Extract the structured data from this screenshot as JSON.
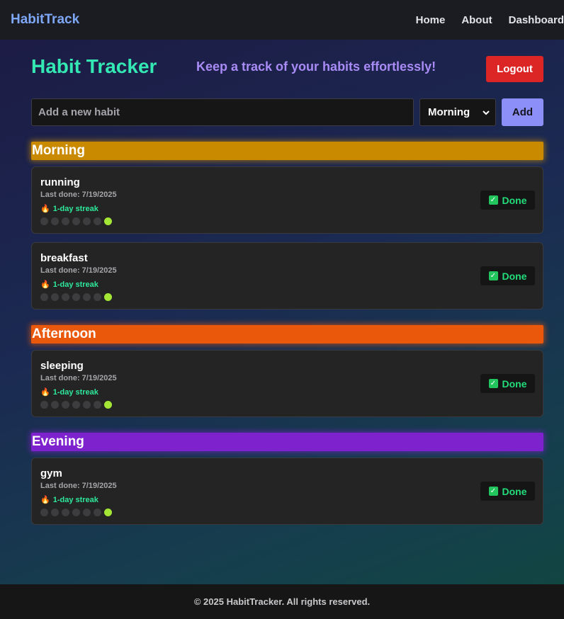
{
  "nav": {
    "brand": "HabitTrack",
    "links": [
      "Home",
      "About",
      "Dashboard"
    ]
  },
  "header": {
    "title": "Habit Tracker",
    "subtitle": "Keep a track of your habits effortlessly!",
    "logout_label": "Logout"
  },
  "add_form": {
    "placeholder": "Add a new habit",
    "value": "",
    "selected_time": "Morning",
    "add_label": "Add"
  },
  "sections": [
    {
      "name": "Morning",
      "color": "#c98a00",
      "habits": [
        {
          "name": "running",
          "last_done": "Last done: 7/19/2025",
          "streak": "1-day streak",
          "done_label": "Done",
          "history": [
            0,
            0,
            0,
            0,
            0,
            0,
            1
          ]
        },
        {
          "name": "breakfast",
          "last_done": "Last done: 7/19/2025",
          "streak": "1-day streak",
          "done_label": "Done",
          "history": [
            0,
            0,
            0,
            0,
            0,
            0,
            1
          ]
        }
      ]
    },
    {
      "name": "Afternoon",
      "color": "#ea580c",
      "habits": [
        {
          "name": "sleeping",
          "last_done": "Last done: 7/19/2025",
          "streak": "1-day streak",
          "done_label": "Done",
          "history": [
            0,
            0,
            0,
            0,
            0,
            0,
            1
          ]
        }
      ]
    },
    {
      "name": "Evening",
      "color": "#7e22ce",
      "habits": [
        {
          "name": "gym",
          "last_done": "Last done: 7/19/2025",
          "streak": "1-day streak",
          "done_label": "Done",
          "history": [
            0,
            0,
            0,
            0,
            0,
            0,
            1
          ]
        }
      ]
    }
  ],
  "footer": {
    "text": "© 2025 HabitTracker. All rights reserved."
  }
}
